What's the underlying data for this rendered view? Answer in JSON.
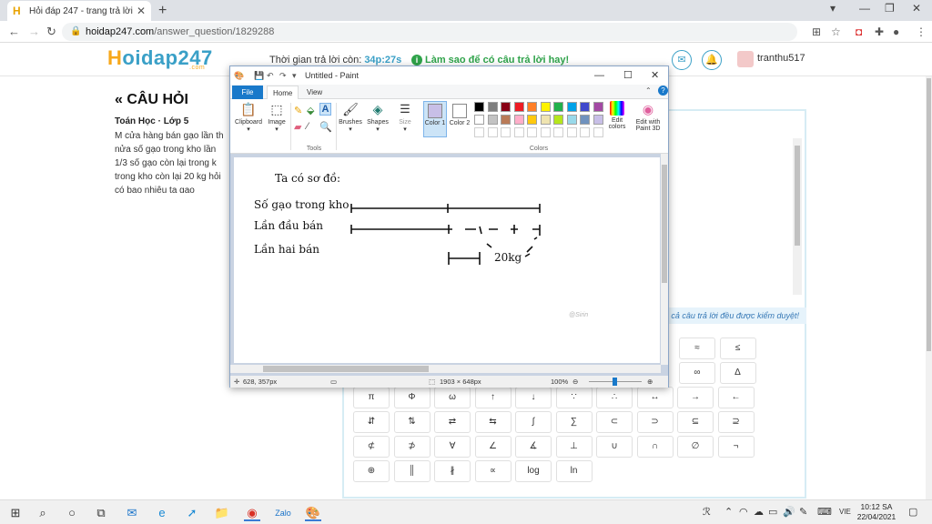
{
  "browser": {
    "tab_title": "Hỏi đáp 247 - trang trả lời",
    "tab_favicon": "H",
    "close_tab": "✕",
    "new_tab": "+",
    "url_domain": "hoidap247.com",
    "url_path": "/answer_question/1829288"
  },
  "site": {
    "logo_h": "H",
    "logo_rest": "oidap247",
    "logo_com": ".com",
    "timer_label": "Thời gian trả lời còn:",
    "timer_value": "34p:27s",
    "howto": "Làm sao để có câu trả lời hay!",
    "username": "tranthu517"
  },
  "question": {
    "header": "« CÂU HỎI",
    "subject": "Toán Học · Lớp 5",
    "lines": [
      "M cửa hàng bán gạo lần th",
      "nửa số gạo trong kho lần",
      "1/3 số gạo còn lại trong k",
      "trong kho còn lại 20 kg hỏi",
      "có bao nhiêu tạ gạo"
    ]
  },
  "answer_panel": {
    "notice": "cả câu trả lời đều được kiểm duyệt!",
    "symbols": [
      [
        "≈",
        "≤"
      ],
      [
        "∞",
        "Δ"
      ],
      [
        "π",
        "Φ",
        "ω",
        "↑",
        "↓",
        "∵",
        "∴",
        "↔",
        "→",
        "←"
      ],
      [
        "⇵",
        "⇅",
        "⇄",
        "⇆",
        "∫",
        "∑",
        "⊂",
        "⊃",
        "⊆",
        "⊇"
      ],
      [
        "⊄",
        "⊅",
        "∀",
        "∠",
        "∡",
        "⊥",
        "∪",
        "∩",
        "∅",
        "¬"
      ],
      [
        "⊕",
        "║",
        "∦",
        "∝",
        "log",
        "ln"
      ]
    ]
  },
  "paint": {
    "title": "Untitled - Paint",
    "tabs": [
      "File",
      "Home",
      "View"
    ],
    "groups": {
      "clipboard": "Clipboard",
      "image": "Image",
      "tools": "Tools",
      "brushes": "Brushes",
      "shapes": "Shapes",
      "size": "Size",
      "color1": "Color 1",
      "color2": "Color 2",
      "colors": "Colors",
      "edit_colors": "Edit colors",
      "edit_3d": "Edit with Paint 3D"
    },
    "palette_row1": [
      "#000000",
      "#7f7f7f",
      "#880015",
      "#ed1c24",
      "#ff7f27",
      "#fff200",
      "#22b14c",
      "#00a2e8",
      "#3f48cc",
      "#a349a4"
    ],
    "palette_row2": [
      "#ffffff",
      "#c3c3c3",
      "#b97a57",
      "#ffaec9",
      "#ffc90e",
      "#efe4b0",
      "#b5e61d",
      "#99d9ea",
      "#7092be",
      "#c8bfe7"
    ],
    "color1": "#c8bfe7",
    "color2": "#ffffff",
    "status": {
      "cursor": "628, 357px",
      "size": "1903 × 648px",
      "zoom": "100%"
    },
    "drawing": {
      "heading": "Ta có sơ đồ:",
      "row1": "Số gạo trong kho",
      "row2": "Lần đầu bán",
      "row3": "Lần hai bán",
      "label": "20kg",
      "watermark": "@Sirin"
    }
  },
  "taskbar": {
    "lang": "VIE",
    "time": "10:12 SA",
    "date": "22/04/2021"
  }
}
